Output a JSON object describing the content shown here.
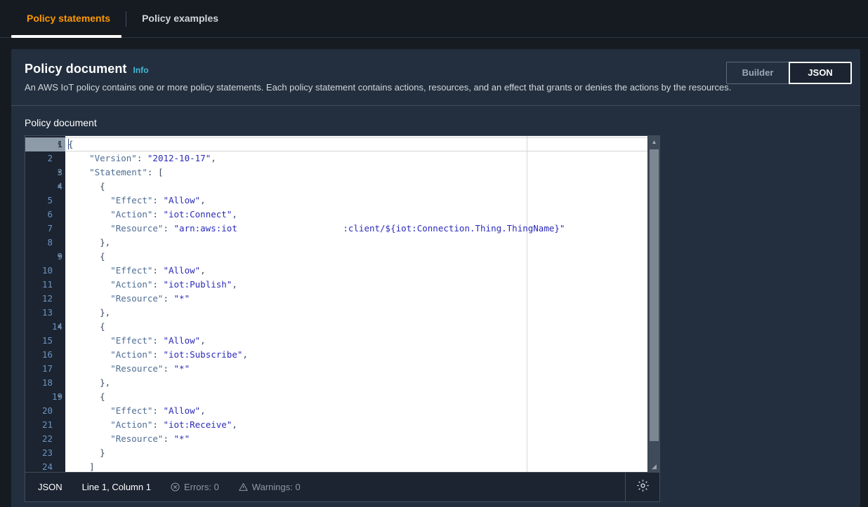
{
  "tabs": [
    {
      "label": "Policy statements",
      "active": true
    },
    {
      "label": "Policy examples",
      "active": false
    }
  ],
  "card": {
    "title": "Policy document",
    "info_label": "Info",
    "description": "An AWS IoT policy contains one or more policy statements. Each policy statement contains actions, resources, and an effect that grants or denies the actions by the resources.",
    "view_toggle": {
      "builder_label": "Builder",
      "json_label": "JSON",
      "selected": "JSON"
    }
  },
  "editor": {
    "label": "Policy document",
    "active_line": 1,
    "lines": [
      {
        "n": 1,
        "fold": true,
        "tokens": [
          {
            "t": "p",
            "v": "{"
          }
        ]
      },
      {
        "n": 2,
        "fold": false,
        "tokens": [
          {
            "t": "k",
            "v": "    \"Version\""
          },
          {
            "t": "p",
            "v": ": "
          },
          {
            "t": "s",
            "v": "\"2012-10-17\""
          },
          {
            "t": "p",
            "v": ","
          }
        ]
      },
      {
        "n": 3,
        "fold": true,
        "tokens": [
          {
            "t": "k",
            "v": "    \"Statement\""
          },
          {
            "t": "p",
            "v": ": ["
          }
        ]
      },
      {
        "n": 4,
        "fold": true,
        "tokens": [
          {
            "t": "p",
            "v": "      {"
          }
        ]
      },
      {
        "n": 5,
        "fold": false,
        "tokens": [
          {
            "t": "k",
            "v": "        \"Effect\""
          },
          {
            "t": "p",
            "v": ": "
          },
          {
            "t": "s",
            "v": "\"Allow\""
          },
          {
            "t": "p",
            "v": ","
          }
        ]
      },
      {
        "n": 6,
        "fold": false,
        "tokens": [
          {
            "t": "k",
            "v": "        \"Action\""
          },
          {
            "t": "p",
            "v": ": "
          },
          {
            "t": "s",
            "v": "\"iot:Connect\""
          },
          {
            "t": "p",
            "v": ","
          }
        ]
      },
      {
        "n": 7,
        "fold": false,
        "tokens": [
          {
            "t": "k",
            "v": "        \"Resource\""
          },
          {
            "t": "p",
            "v": ": "
          },
          {
            "t": "s",
            "v": "\"arn:aws:iot                    :client/${iot:Connection.Thing.ThingName}\""
          }
        ]
      },
      {
        "n": 8,
        "fold": false,
        "tokens": [
          {
            "t": "p",
            "v": "      },"
          }
        ]
      },
      {
        "n": 9,
        "fold": true,
        "tokens": [
          {
            "t": "p",
            "v": "      {"
          }
        ]
      },
      {
        "n": 10,
        "fold": false,
        "tokens": [
          {
            "t": "k",
            "v": "        \"Effect\""
          },
          {
            "t": "p",
            "v": ": "
          },
          {
            "t": "s",
            "v": "\"Allow\""
          },
          {
            "t": "p",
            "v": ","
          }
        ]
      },
      {
        "n": 11,
        "fold": false,
        "tokens": [
          {
            "t": "k",
            "v": "        \"Action\""
          },
          {
            "t": "p",
            "v": ": "
          },
          {
            "t": "s",
            "v": "\"iot:Publish\""
          },
          {
            "t": "p",
            "v": ","
          }
        ]
      },
      {
        "n": 12,
        "fold": false,
        "tokens": [
          {
            "t": "k",
            "v": "        \"Resource\""
          },
          {
            "t": "p",
            "v": ": "
          },
          {
            "t": "s",
            "v": "\"*\""
          }
        ]
      },
      {
        "n": 13,
        "fold": false,
        "tokens": [
          {
            "t": "p",
            "v": "      },"
          }
        ]
      },
      {
        "n": 14,
        "fold": true,
        "tokens": [
          {
            "t": "p",
            "v": "      {"
          }
        ]
      },
      {
        "n": 15,
        "fold": false,
        "tokens": [
          {
            "t": "k",
            "v": "        \"Effect\""
          },
          {
            "t": "p",
            "v": ": "
          },
          {
            "t": "s",
            "v": "\"Allow\""
          },
          {
            "t": "p",
            "v": ","
          }
        ]
      },
      {
        "n": 16,
        "fold": false,
        "tokens": [
          {
            "t": "k",
            "v": "        \"Action\""
          },
          {
            "t": "p",
            "v": ": "
          },
          {
            "t": "s",
            "v": "\"iot:Subscribe\""
          },
          {
            "t": "p",
            "v": ","
          }
        ]
      },
      {
        "n": 17,
        "fold": false,
        "tokens": [
          {
            "t": "k",
            "v": "        \"Resource\""
          },
          {
            "t": "p",
            "v": ": "
          },
          {
            "t": "s",
            "v": "\"*\""
          }
        ]
      },
      {
        "n": 18,
        "fold": false,
        "tokens": [
          {
            "t": "p",
            "v": "      },"
          }
        ]
      },
      {
        "n": 19,
        "fold": true,
        "tokens": [
          {
            "t": "p",
            "v": "      {"
          }
        ]
      },
      {
        "n": 20,
        "fold": false,
        "tokens": [
          {
            "t": "k",
            "v": "        \"Effect\""
          },
          {
            "t": "p",
            "v": ": "
          },
          {
            "t": "s",
            "v": "\"Allow\""
          },
          {
            "t": "p",
            "v": ","
          }
        ]
      },
      {
        "n": 21,
        "fold": false,
        "tokens": [
          {
            "t": "k",
            "v": "        \"Action\""
          },
          {
            "t": "p",
            "v": ": "
          },
          {
            "t": "s",
            "v": "\"iot:Receive\""
          },
          {
            "t": "p",
            "v": ","
          }
        ]
      },
      {
        "n": 22,
        "fold": false,
        "tokens": [
          {
            "t": "k",
            "v": "        \"Resource\""
          },
          {
            "t": "p",
            "v": ": "
          },
          {
            "t": "s",
            "v": "\"*\""
          }
        ]
      },
      {
        "n": 23,
        "fold": false,
        "tokens": [
          {
            "t": "p",
            "v": "      }"
          }
        ]
      },
      {
        "n": 24,
        "fold": false,
        "tokens": [
          {
            "t": "p",
            "v": "    ]"
          }
        ]
      }
    ]
  },
  "statusbar": {
    "language": "JSON",
    "cursor": "Line 1, Column 1",
    "errors": "Errors: 0",
    "warnings": "Warnings: 0",
    "settings_icon": "gear-icon"
  },
  "colors": {
    "page_bg": "#161b22",
    "card_bg": "#232f3e",
    "accent_orange": "#ff9900",
    "info_blue": "#44b9d6",
    "editor_bg": "#ffffff",
    "gutter_bg": "#1b2430"
  }
}
